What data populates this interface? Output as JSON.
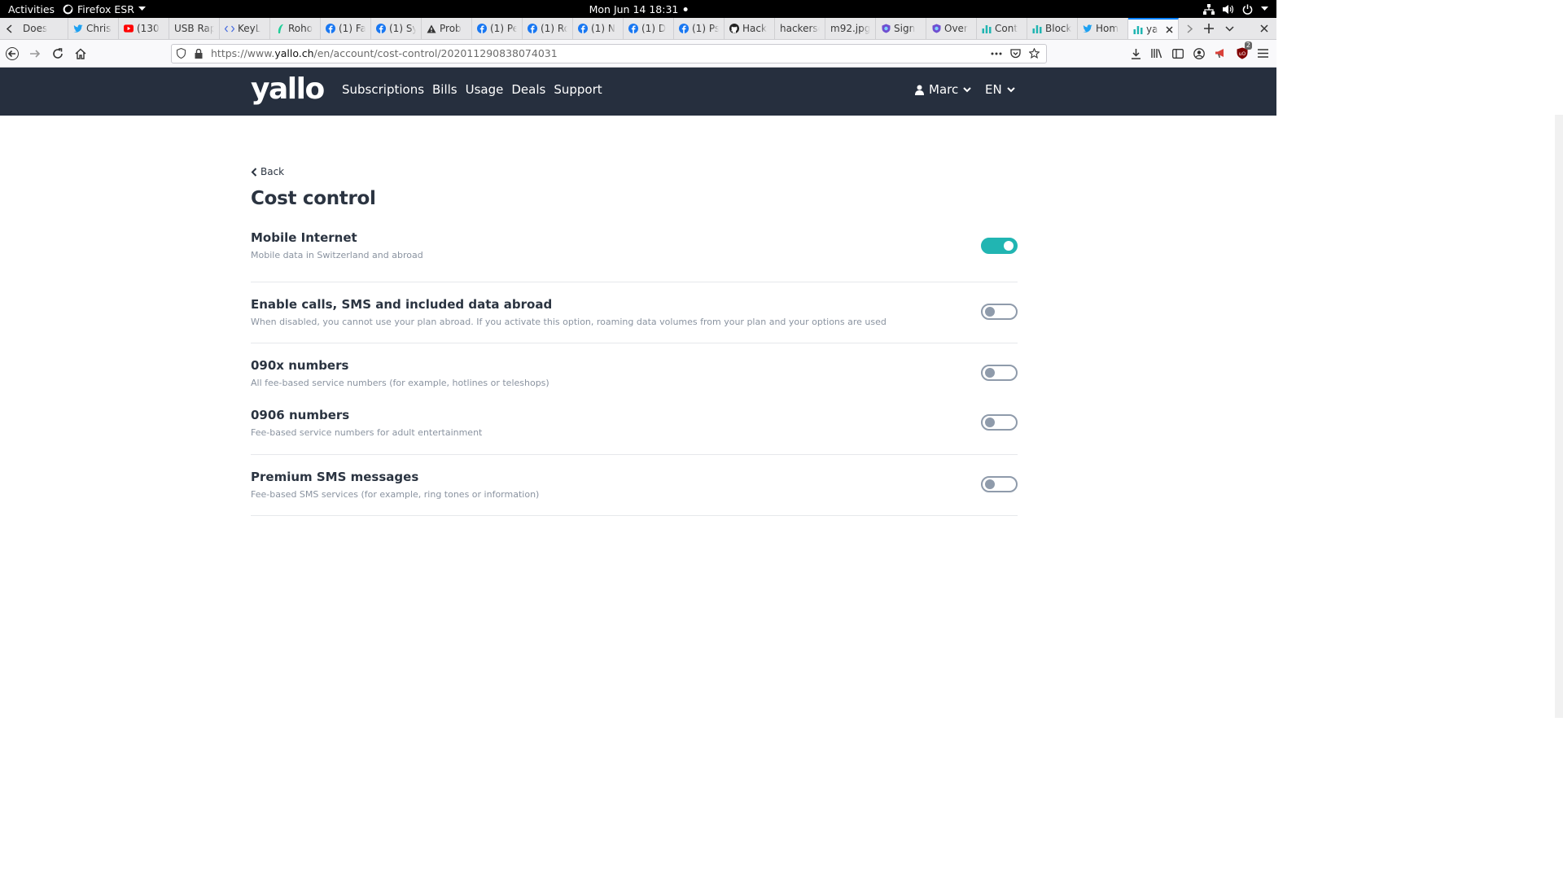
{
  "system_bar": {
    "activities": "Activities",
    "app_name": "Firefox ESR",
    "clock": "Mon Jun 14  18:31"
  },
  "tabs": [
    {
      "title": "Does",
      "icon": "generic-page-icon"
    },
    {
      "title": "Chris",
      "icon": "twitter-icon"
    },
    {
      "title": "(130",
      "icon": "youtube-icon"
    },
    {
      "title": "USB Rap",
      "icon": "none"
    },
    {
      "title": "KeyL",
      "icon": "code-icon"
    },
    {
      "title": "Roho",
      "icon": "robinhood-icon"
    },
    {
      "title": "(1) Fa",
      "icon": "facebook-icon"
    },
    {
      "title": "(1) Sy",
      "icon": "facebook-icon"
    },
    {
      "title": "Prob",
      "icon": "warning-icon"
    },
    {
      "title": "(1) Pe",
      "icon": "facebook-icon"
    },
    {
      "title": "(1) Ro",
      "icon": "facebook-icon"
    },
    {
      "title": "(1) N",
      "icon": "facebook-icon"
    },
    {
      "title": "(1) D",
      "icon": "facebook-icon"
    },
    {
      "title": "(1) Ps",
      "icon": "facebook-icon"
    },
    {
      "title": "Hack",
      "icon": "github-icon"
    },
    {
      "title": "hackersc",
      "icon": "none"
    },
    {
      "title": "m92.jpg",
      "icon": "none"
    },
    {
      "title": "Sign",
      "icon": "shield-icon"
    },
    {
      "title": "Over",
      "icon": "shield-icon"
    },
    {
      "title": "Cont",
      "icon": "bar-chart-icon"
    },
    {
      "title": "Block",
      "icon": "bar-chart-icon"
    },
    {
      "title": "Hom",
      "icon": "twitter-icon"
    },
    {
      "title": "ya",
      "icon": "bar-chart-icon",
      "active": true
    }
  ],
  "url": {
    "prefix": "https://www.",
    "domain": "yallo.ch",
    "path": "/en/account/cost-control/202011290838074031"
  },
  "toolbar": {
    "notification_count": "2"
  },
  "site": {
    "logo": "yallo",
    "nav": [
      "Subscriptions",
      "Bills",
      "Usage",
      "Deals",
      "Support"
    ],
    "user": "Marc",
    "language": "EN"
  },
  "page": {
    "back_label": "Back",
    "title": "Cost control"
  },
  "settings": [
    {
      "title": "Mobile Internet",
      "description": "Mobile data in Switzerland and abroad",
      "enabled": true
    },
    {
      "title": "Enable calls, SMS and included data abroad",
      "description": "When disabled, you cannot use your plan abroad. If you activate this option, roaming data volumes from your plan and your options are used",
      "enabled": false
    },
    {
      "title": "090x numbers",
      "description": "All fee-based service numbers (for example, hotlines or teleshops)",
      "enabled": false
    },
    {
      "title": "0906 numbers",
      "description": "Fee-based service numbers for adult entertainment",
      "enabled": false
    },
    {
      "title": "Premium SMS messages",
      "description": "Fee-based SMS services (for example, ring tones or information)",
      "enabled": false
    }
  ],
  "colors": {
    "header_bg": "#262f3e",
    "toggle_on": "#21b5b2",
    "toggle_off": "#8f9bab"
  }
}
